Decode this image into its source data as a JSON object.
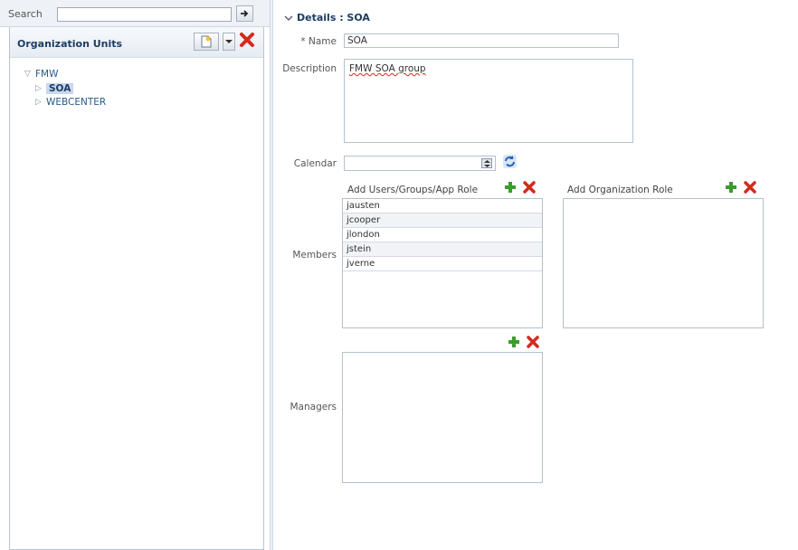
{
  "search": {
    "label": "Search",
    "value": "",
    "placeholder": ""
  },
  "org_units": {
    "title": "Organization Units",
    "tree": {
      "root": "FMW",
      "children": [
        "SOA",
        "WEBCENTER"
      ]
    }
  },
  "details": {
    "header": "Details : SOA",
    "name_label": "* Name",
    "name_value": "SOA",
    "description_label": "Description",
    "description_value": "FMW SOA group",
    "calendar_label": "Calendar",
    "calendar_value": ""
  },
  "members": {
    "label": "Members",
    "users_header": "Add Users/Groups/App Role",
    "users": [
      "jausten",
      "jcooper",
      "jlondon",
      "jstein",
      "jverne"
    ],
    "roles_header": "Add Organization Role",
    "roles": []
  },
  "managers": {
    "label": "Managers",
    "items": []
  },
  "colors": {
    "add": "#3a9d2a",
    "remove": "#d32a1e",
    "selected_bg": "#c9d7ee",
    "link": "#2a5a8c"
  }
}
